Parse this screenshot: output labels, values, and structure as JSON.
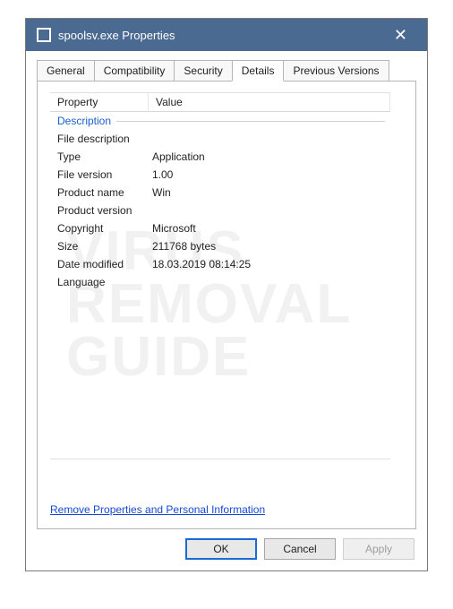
{
  "titlebar": {
    "title": "spoolsv.exe Properties"
  },
  "tabs": {
    "general": "General",
    "compatibility": "Compatibility",
    "security": "Security",
    "details": "Details",
    "previous": "Previous Versions"
  },
  "grid": {
    "header": {
      "property": "Property",
      "value": "Value"
    },
    "group": "Description",
    "rows": {
      "file_description": {
        "label": "File description",
        "value": ""
      },
      "type": {
        "label": "Type",
        "value": "Application"
      },
      "file_version": {
        "label": "File version",
        "value": "1.00"
      },
      "product_name": {
        "label": "Product name",
        "value": "Win"
      },
      "product_version": {
        "label": "Product version",
        "value": ""
      },
      "copyright": {
        "label": "Copyright",
        "value": "Microsoft"
      },
      "size": {
        "label": "Size",
        "value": "211768 bytes"
      },
      "date_modified": {
        "label": "Date modified",
        "value": "18.03.2019 08:14:25"
      },
      "language": {
        "label": "Language",
        "value": ""
      }
    }
  },
  "link": "Remove Properties and Personal Information",
  "buttons": {
    "ok": "OK",
    "cancel": "Cancel",
    "apply": "Apply"
  },
  "watermark": {
    "l1": "VIRUS",
    "l2": "REMOVAL",
    "l3": "GUIDE"
  }
}
